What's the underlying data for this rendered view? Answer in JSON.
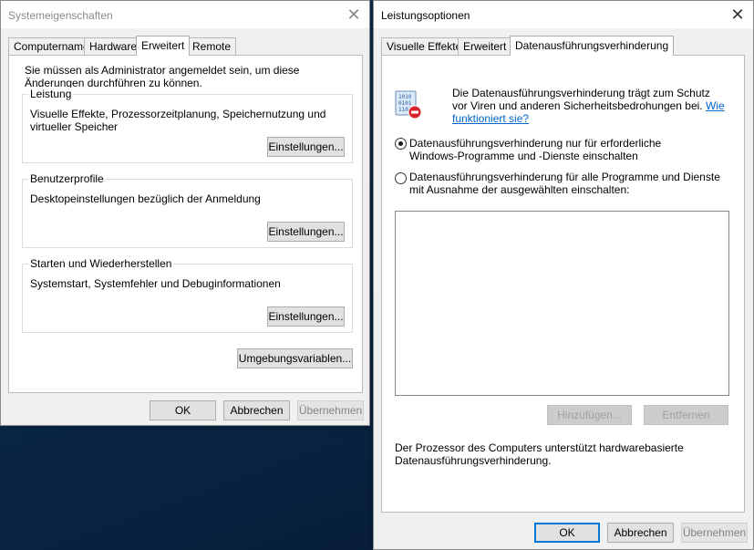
{
  "system_properties": {
    "title": "Systemeigenschaften",
    "tabs": [
      "Computername",
      "Hardware",
      "Erweitert",
      "Remote"
    ],
    "admin_notice": "Sie müssen als Administrator angemeldet sein, um diese Änderungen durchführen zu können.",
    "groups": [
      {
        "title": "Leistung",
        "description": "Visuelle Effekte, Prozessorzeitplanung, Speichernutzung und virtueller Speicher",
        "button": "Einstellungen..."
      },
      {
        "title": "Benutzerprofile",
        "description": "Desktopeinstellungen bezüglich der Anmeldung",
        "button": "Einstellungen..."
      },
      {
        "title": "Starten und Wiederherstellen",
        "description": "Systemstart, Systemfehler und Debuginformationen",
        "button": "Einstellungen..."
      }
    ],
    "env_button": "Umgebungsvariablen...",
    "ok": "OK",
    "cancel": "Abbrechen",
    "apply": "Übernehmen"
  },
  "performance_options": {
    "title": "Leistungsoptionen",
    "tabs": [
      "Visuelle Effekte",
      "Erweitert",
      "Datenausführungsverhinderung"
    ],
    "info_text": "Die Datenausführungsverhinderung trägt zum Schutz vor Viren und anderen Sicherheitsbedrohungen bei.",
    "info_link": "Wie funktioniert sie?",
    "radio_essential": "Datenausführungsverhinderung nur für erforderliche Windows-Programme und -Dienste einschalten",
    "radio_all": "Datenausführungsverhinderung für alle Programme und Dienste mit Ausnahme der ausgewählten einschalten:",
    "selected_option": "essential",
    "add_button": "Hinzufügen...",
    "remove_button": "Entfernen",
    "processor_note": "Der Prozessor des Computers unterstützt hardwarebasierte Datenausführungsverhinderung.",
    "ok": "OK",
    "cancel": "Abbrechen",
    "apply": "Übernehmen"
  },
  "icons": {
    "dep": "dep-shield-icon",
    "close": "close-icon"
  }
}
